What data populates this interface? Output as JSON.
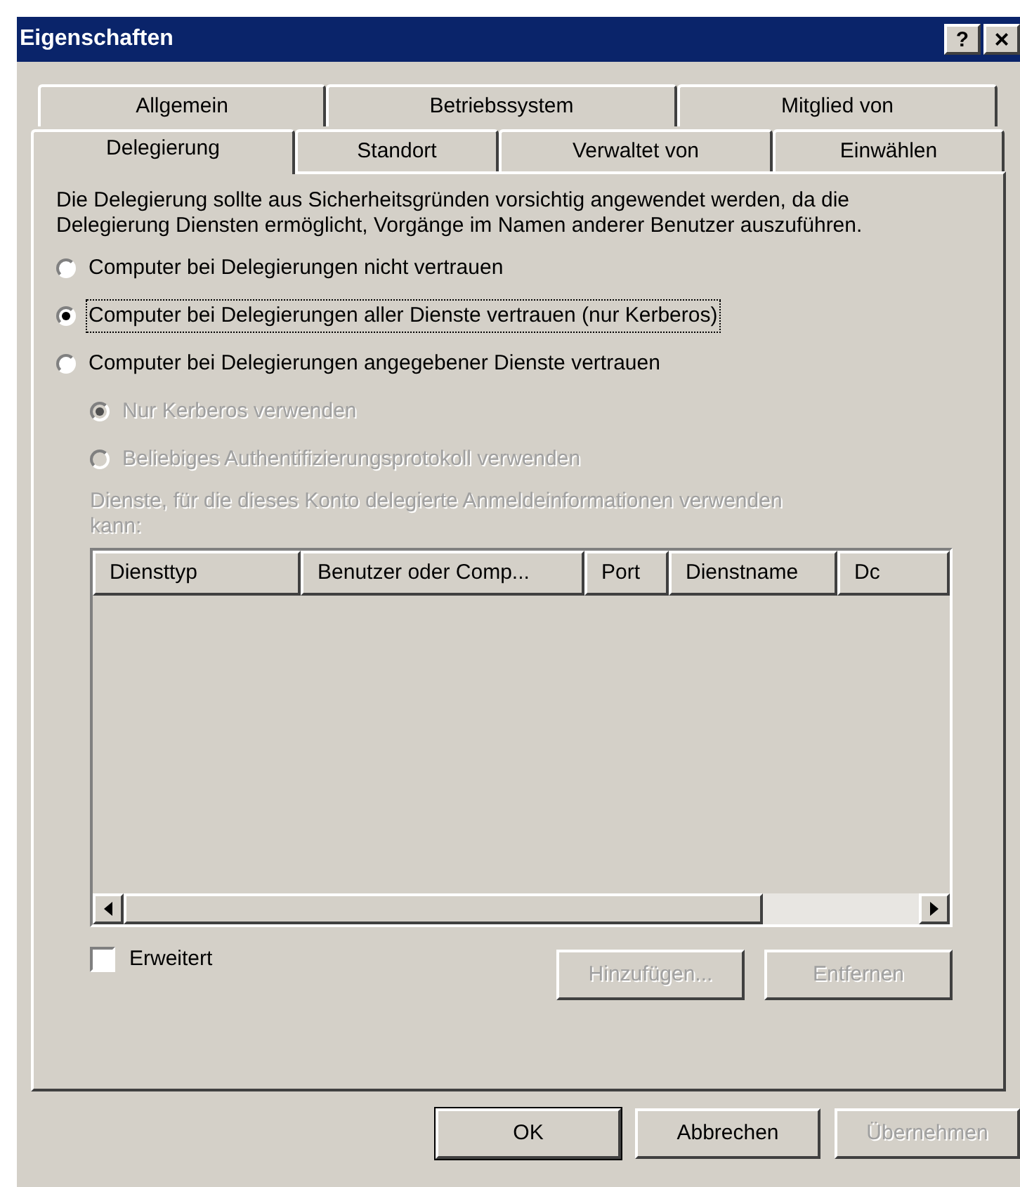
{
  "window": {
    "title": "Eigenschaften",
    "help_button": "?",
    "close_button": "×"
  },
  "tab_rows": [
    [
      {
        "label": "Allgemein",
        "selected": false
      },
      {
        "label": "Betriebssystem",
        "selected": false
      },
      {
        "label": "Mitglied von",
        "selected": false
      }
    ],
    [
      {
        "label": "Delegierung",
        "selected": true
      },
      {
        "label": "Standort",
        "selected": false
      },
      {
        "label": "Verwaltet von",
        "selected": false
      },
      {
        "label": "Einwählen",
        "selected": false
      }
    ]
  ],
  "description": "Die Delegierung sollte aus Sicherheitsgründen vorsichtig angewendet werden, da die Delegierung Diensten ermöglicht, Vorgänge im Namen anderer Benutzer auszuführen.",
  "trust_options": [
    {
      "label": "Computer bei Delegierungen nicht vertrauen",
      "selected": false,
      "focused": false
    },
    {
      "label": "Computer bei Delegierungen aller Dienste vertrauen (nur Kerberos)",
      "selected": true,
      "focused": true
    },
    {
      "label": "Computer bei Delegierungen angegebener Dienste vertrauen",
      "selected": false,
      "focused": false
    }
  ],
  "protocol_options": [
    {
      "label": "Nur Kerberos verwenden",
      "selected": true,
      "disabled": true
    },
    {
      "label": "Beliebiges Authentifizierungsprotokoll verwenden",
      "selected": false,
      "disabled": true
    }
  ],
  "services_label": "Dienste, für die dieses Konto delegierte Anmeldeinformationen verwenden kann:",
  "services_table": {
    "disabled": true,
    "columns": [
      "Diensttyp",
      "Benutzer oder Comp...",
      "Port",
      "Dienstname",
      "Dc"
    ]
  },
  "expanded_checkbox": {
    "label": "Erweitert",
    "checked": false
  },
  "list_buttons": [
    {
      "label": "Hinzufügen...",
      "disabled": true
    },
    {
      "label": "Entfernen",
      "disabled": true
    }
  ],
  "dialog_buttons": [
    {
      "label": "OK",
      "disabled": false,
      "default": true
    },
    {
      "label": "Abbrechen",
      "disabled": false,
      "default": false
    },
    {
      "label": "Übernehmen",
      "disabled": true,
      "default": false
    }
  ]
}
